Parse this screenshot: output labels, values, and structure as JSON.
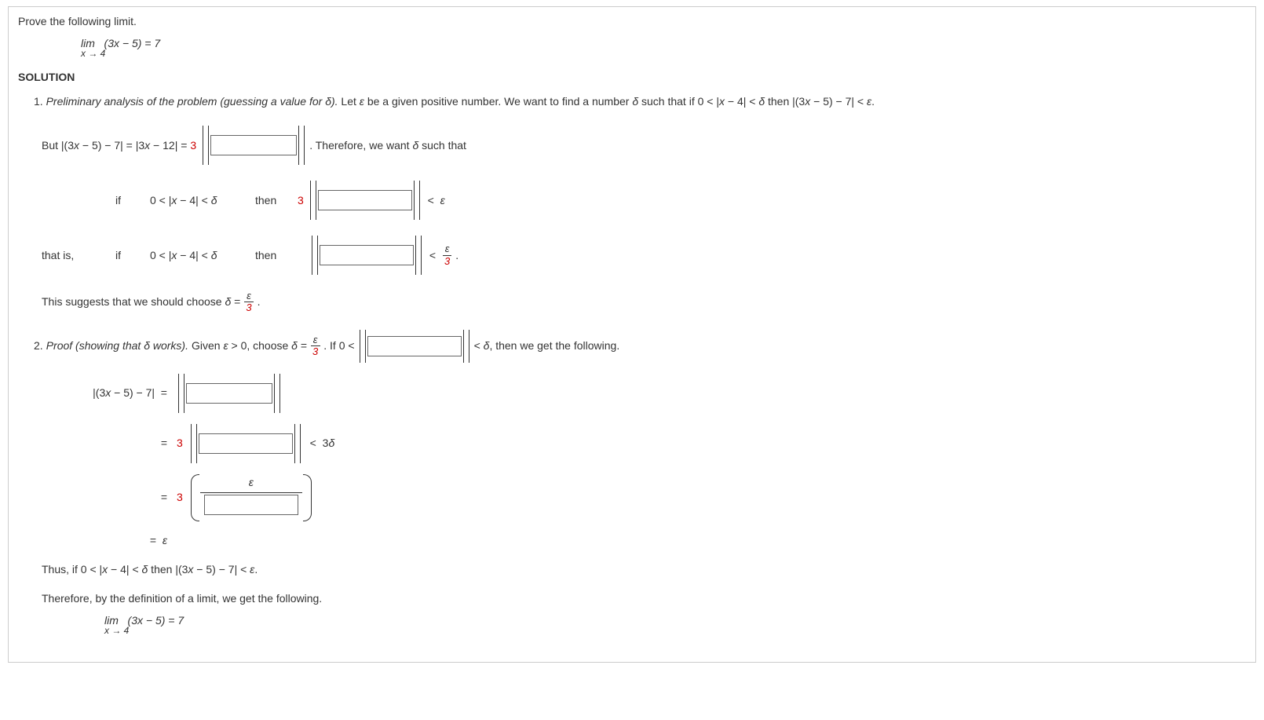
{
  "prompt": "Prove the following limit.",
  "limit": {
    "top": "lim   (3x − 5) = 7",
    "bottom": "x → 4"
  },
  "solution_header": "SOLUTION",
  "step1": {
    "label": "1. ",
    "heading": "Preliminary analysis of the problem (guessing a value for δ).",
    "text_a": " Let ε be a given positive number. We want to find a number δ such that if 0 < |x − 4| < δ then |(3x − 5) − 7| < ε.",
    "but": "But |(3x − 5) − 7| = |3x − 12| = ",
    "coef3": "3",
    "after_abs": ". Therefore, we want δ such that",
    "if": "if",
    "cond": "0 < |x − 4| < δ",
    "then": "then",
    "lt_eps": " <  ε",
    "that_is": "that is,",
    "lt_frac_label": " < ",
    "eps": "ε",
    "three": "3",
    "suggest": "This suggests that we should choose δ = ",
    "period": "."
  },
  "step2": {
    "label": "2. ",
    "heading": "Proof (showing that δ works).",
    "text_a": " Given ε > 0, choose δ = ",
    "text_b": ". If 0 < ",
    "text_c": " < δ, then we get the following.",
    "lhs": "|(3x − 5) − 7|  =",
    "eq": "=",
    "coef3": "3",
    "lt_3delta": " <  3δ",
    "eq_eps": "=  ε",
    "thus": "Thus, if 0 < |x − 4| < δ then |(3x − 5) − 7| < ε.",
    "therefore": "Therefore, by the definition of a limit, we get the following."
  }
}
